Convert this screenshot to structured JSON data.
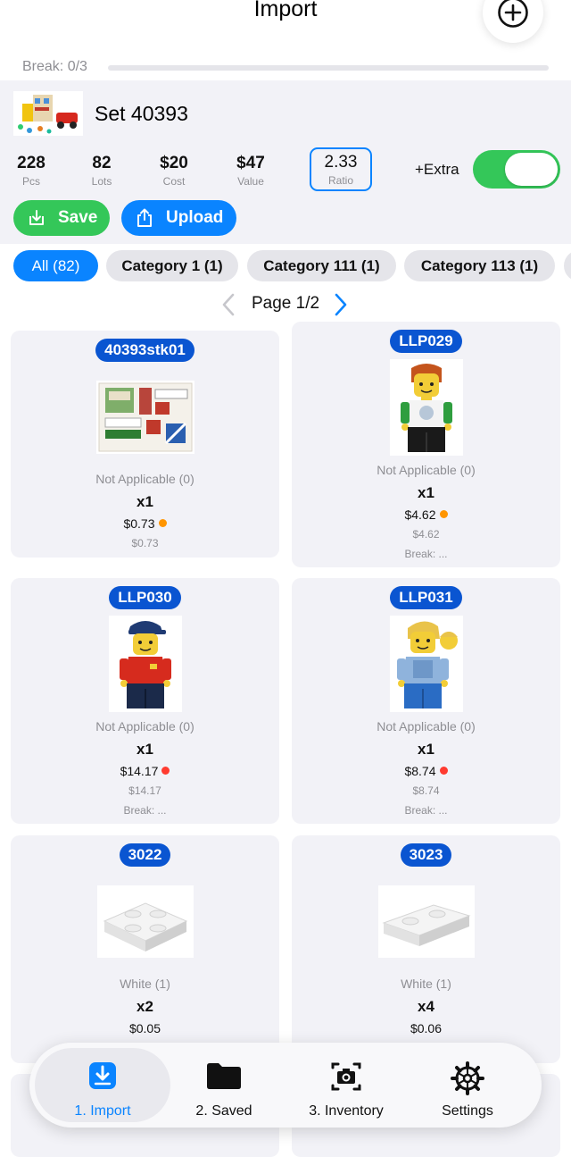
{
  "header": {
    "title": "Import",
    "break_text": "Break: 0/3",
    "break_progress": 0
  },
  "set": {
    "name": "Set 40393",
    "stats": [
      {
        "value": "228",
        "label": "Pcs"
      },
      {
        "value": "82",
        "label": "Lots"
      },
      {
        "value": "$20",
        "label": "Cost"
      },
      {
        "value": "$47",
        "label": "Value"
      }
    ],
    "ratio": {
      "value": "2.33",
      "label": "Ratio"
    },
    "extra_label": "+Extra",
    "extra_enabled": true,
    "save_label": "Save",
    "upload_label": "Upload"
  },
  "filters": [
    {
      "label": "All (82)",
      "active": true
    },
    {
      "label": "Category 1 (1)",
      "active": false
    },
    {
      "label": "Category 111 (1)",
      "active": false
    },
    {
      "label": "Category 113 (1)",
      "active": false
    }
  ],
  "pager": {
    "label": "Page 1/2"
  },
  "items": [
    {
      "id": "40393stk01",
      "image": "sticker-sheet",
      "condition": "Not Applicable (0)",
      "qty": "x1",
      "price": "$0.73",
      "status_color": "#ff9500",
      "sub_price": "$0.73",
      "break": ""
    },
    {
      "id": "LLP029",
      "image": "minifig-green-shirt",
      "condition": "Not Applicable (0)",
      "qty": "x1",
      "price": "$4.62",
      "status_color": "#ff9500",
      "sub_price": "$4.62",
      "break": "Break: ..."
    },
    {
      "id": "LLP030",
      "image": "minifig-red-shirt",
      "condition": "Not Applicable (0)",
      "qty": "x1",
      "price": "$14.17",
      "status_color": "#ff3b30",
      "sub_price": "$14.17",
      "break": "Break: ..."
    },
    {
      "id": "LLP031",
      "image": "minifig-blue-overalls",
      "condition": "Not Applicable (0)",
      "qty": "x1",
      "price": "$8.74",
      "status_color": "#ff3b30",
      "sub_price": "$8.74",
      "break": "Break: ..."
    },
    {
      "id": "3022",
      "image": "plate-2x2-white",
      "condition": "White (1)",
      "qty": "x2",
      "price": "$0.05",
      "status_color": "",
      "sub_price": "",
      "break": ""
    },
    {
      "id": "3023",
      "image": "plate-1x2-white",
      "condition": "White (1)",
      "qty": "x4",
      "price": "$0.06",
      "status_color": "",
      "sub_price": "",
      "break": ""
    }
  ],
  "tabs": [
    {
      "label": "1. Import",
      "icon": "import-icon",
      "active": true
    },
    {
      "label": "2. Saved",
      "icon": "folder-icon",
      "active": false
    },
    {
      "label": "3. Inventory",
      "icon": "camera-icon",
      "active": false
    },
    {
      "label": "Settings",
      "icon": "gear-icon",
      "active": false
    }
  ],
  "colors": {
    "accent": "#0a84ff",
    "success": "#34c759",
    "tag": "#0a55d1",
    "warning": "#ff9500",
    "danger": "#ff3b30"
  }
}
